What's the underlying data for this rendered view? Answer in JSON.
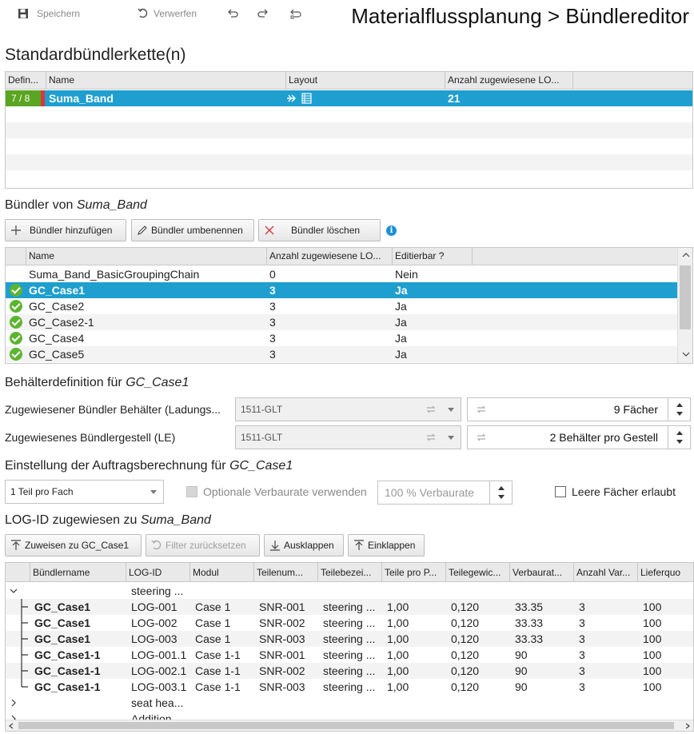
{
  "toolbar": {
    "save": "Speichern",
    "discard": "Verwerfen"
  },
  "app_title": "Materialflussplanung > Bündlereditor",
  "chains": {
    "title": "Standardbündlerkette(n)",
    "headers": [
      "Defin...",
      "Name",
      "Layout",
      "Anzahl zugewiesene LO..."
    ],
    "rows": [
      {
        "def": "7 / 8",
        "name": "Suma_Band",
        "count": "21"
      }
    ]
  },
  "bundlers": {
    "title_prefix": "Bündler von ",
    "title_name": "Suma_Band",
    "btn_add": "Bündler hinzufügen",
    "btn_rename": "Bündler umbenennen",
    "btn_delete": "Bündler löschen",
    "headers": [
      "Name",
      "Anzahl zugewiesene LO...",
      "Editierbar ?"
    ],
    "rows": [
      {
        "name": "Suma_Band_BasicGroupingChain",
        "count": "0",
        "editable": "Nein",
        "check": false
      },
      {
        "name": "GC_Case1",
        "count": "3",
        "editable": "Ja",
        "check": true,
        "selected": true
      },
      {
        "name": "GC_Case2",
        "count": "3",
        "editable": "Ja",
        "check": true
      },
      {
        "name": "GC_Case2-1",
        "count": "3",
        "editable": "Ja",
        "check": true
      },
      {
        "name": "GC_Case4",
        "count": "3",
        "editable": "Ja",
        "check": true
      },
      {
        "name": "GC_Case5",
        "count": "3",
        "editable": "Ja",
        "check": true
      }
    ]
  },
  "container": {
    "title_prefix": "Behälterdefinition für ",
    "title_name": "GC_Case1",
    "row1_label": "Zugewiesener Bündler Behälter (Ladungs...",
    "row1_value": "1511-GLT",
    "row1_spin": "9 Fächer",
    "row2_label": "Zugewiesenes Bündlergestell (LE)",
    "row2_value": "1511-GLT",
    "row2_spin": "2 Behälter pro Gestell"
  },
  "order": {
    "title_prefix": "Einstellung der Auftragsberechnung für ",
    "title_name": "GC_Case1",
    "mode": "1 Teil pro Fach",
    "optional_rate": "Optionale Verbaurate verwenden",
    "rate_placeholder": "100 % Verbaurate",
    "empty_slots": "Leere Fächer erlaubt"
  },
  "logid": {
    "title_prefix": "LOG-ID zugewiesen zu ",
    "title_name": "Suma_Band",
    "btn_assign": "Zuweisen zu GC_Case1",
    "btn_reset": "Filter zurücksetzen",
    "btn_expand": "Ausklappen",
    "btn_collapse": "Einklappen",
    "headers": [
      "Bündlername",
      "LOG-ID",
      "Modul",
      "Teilenum...",
      "Teilebezei...",
      "Teile pro P...",
      "Teilegewic...",
      "Verbaurat...",
      "Anzahl Var...",
      "Lieferquo"
    ],
    "group1": "steering ...",
    "rows": [
      [
        "GC_Case1",
        "LOG-001",
        "Case 1",
        "SNR-001",
        "steering ...",
        "1,00",
        "0,120",
        "33.35",
        "3",
        "100"
      ],
      [
        "GC_Case1",
        "LOG-002",
        "Case 1",
        "SNR-002",
        "steering ...",
        "1,00",
        "0,120",
        "33.33",
        "3",
        "100"
      ],
      [
        "GC_Case1",
        "LOG-003",
        "Case 1",
        "SNR-003",
        "steering ...",
        "1,00",
        "0,120",
        "33.33",
        "3",
        "100"
      ],
      [
        "GC_Case1-1",
        "LOG-001.1",
        "Case 1-1",
        "SNR-001",
        "steering ...",
        "1,00",
        "0,120",
        "90",
        "3",
        "100"
      ],
      [
        "GC_Case1-1",
        "LOG-002.1",
        "Case 1-1",
        "SNR-002",
        "steering ...",
        "1,00",
        "0,120",
        "90",
        "3",
        "100"
      ],
      [
        "GC_Case1-1",
        "LOG-003.1",
        "Case 1-1",
        "SNR-003",
        "steering ...",
        "1,00",
        "0,120",
        "90",
        "3",
        "100"
      ]
    ],
    "group2": "seat hea...",
    "group3": "Addition..."
  }
}
